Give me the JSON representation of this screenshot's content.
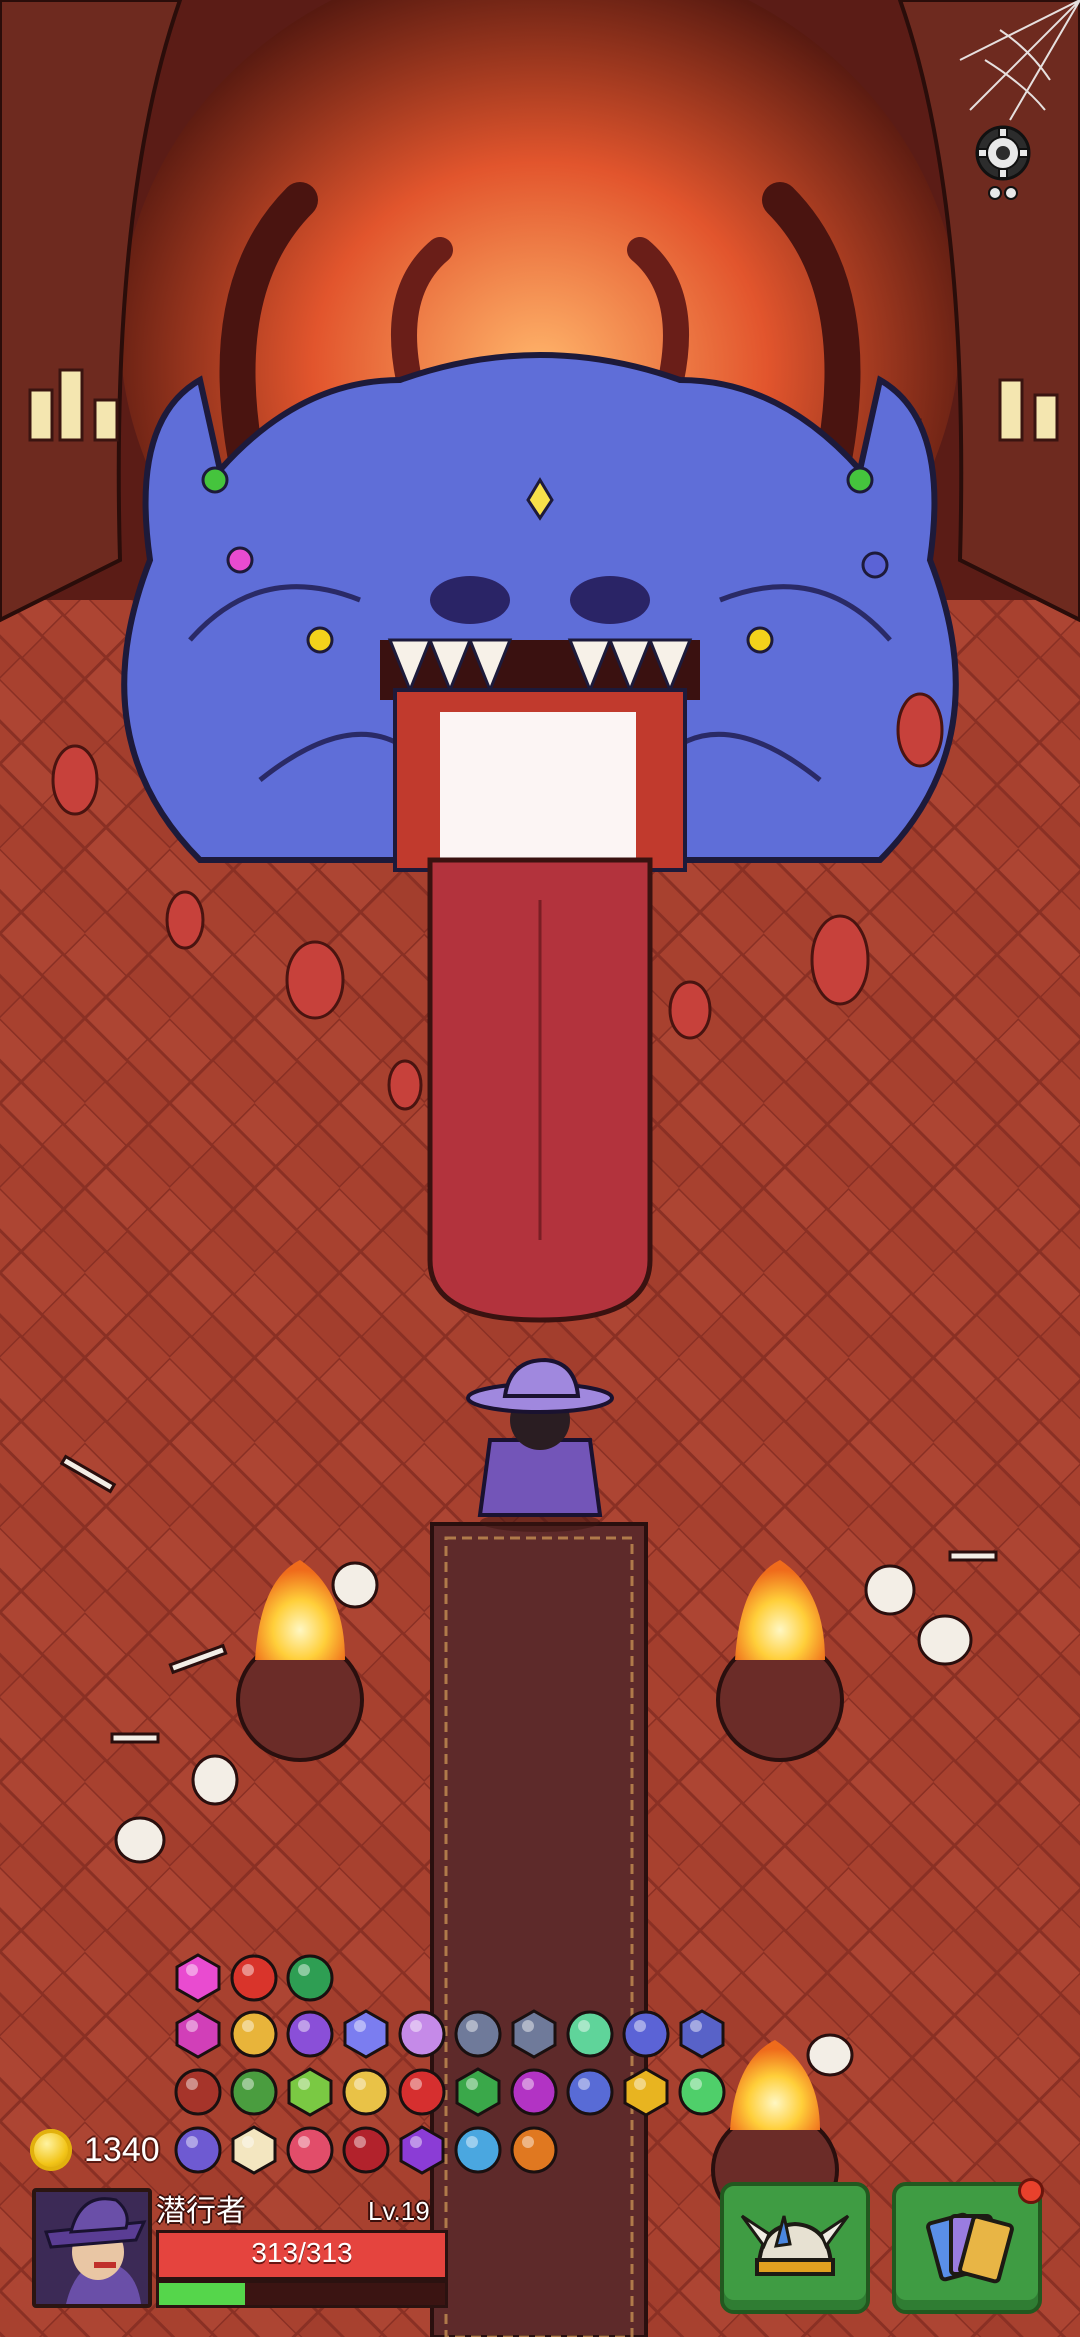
{
  "player": {
    "name": "潜行者",
    "level": "Lv.19",
    "hp_text": "313/313",
    "hp_fraction": 1.0,
    "xp_fraction": 0.3
  },
  "currency": {
    "coins": "1340",
    "icon": "gold-coin-icon"
  },
  "buttons": {
    "settings_icon": "gear-icon",
    "equipment_icon": "viking-helmet-icon",
    "cards_icon": "card-deck-icon"
  },
  "inventory": {
    "items": [
      {
        "icon": "halo-ring-icon",
        "color": "#e94bd0"
      },
      {
        "icon": "fanged-maw-icon",
        "color": "#d9342b"
      },
      {
        "icon": "turtle-shell-icon",
        "color": "#2e9e53"
      },
      {
        "icon": "demon-mask-icon",
        "color": "#d13fb8"
      },
      {
        "icon": "horn-icon",
        "color": "#e8b43a"
      },
      {
        "icon": "shield-badge-icon",
        "color": "#8a4fd8"
      },
      {
        "icon": "blue-flame-icon",
        "color": "#7b7df0"
      },
      {
        "icon": "dice-icon",
        "color": "#c58ae8"
      },
      {
        "icon": "stone-slab-icon",
        "color": "#6f7a9a"
      },
      {
        "icon": "sword-plate-icon",
        "color": "#6f7a9a"
      },
      {
        "icon": "potion-bottle-icon",
        "color": "#5fd49a"
      },
      {
        "icon": "lamp-icon",
        "color": "#5b63d6"
      },
      {
        "icon": "fist-rune-icon",
        "color": "#5862c8"
      },
      {
        "icon": "cube-rune-icon",
        "color": "#a6342a"
      },
      {
        "icon": "star-triangle-icon",
        "color": "#4a9d3f"
      },
      {
        "icon": "green-jar-icon",
        "color": "#7ac943"
      },
      {
        "icon": "flower-pot-icon",
        "color": "#e9c247"
      },
      {
        "icon": "red-demon-icon",
        "color": "#d62f2f"
      },
      {
        "icon": "green-beast-icon",
        "color": "#3aa84a"
      },
      {
        "icon": "purple-gem-icon",
        "color": "#b233c4"
      },
      {
        "icon": "blue-orb-icon",
        "color": "#586bd6"
      },
      {
        "icon": "gold-flower-icon",
        "color": "#e8b420"
      },
      {
        "icon": "green-bracelet-icon",
        "color": "#4fcf6a"
      },
      {
        "icon": "bat-wing-icon",
        "color": "#6e5ad2"
      },
      {
        "icon": "bone-icon",
        "color": "#f3e6c0"
      },
      {
        "icon": "heart-lock-icon",
        "color": "#e24d6a"
      },
      {
        "icon": "red-triangle-icon",
        "color": "#b2222c"
      },
      {
        "icon": "purple-demon-icon",
        "color": "#8b3cd6"
      },
      {
        "icon": "mushroom-icon",
        "color": "#4aa7e0"
      },
      {
        "icon": "bleeding-horn-icon",
        "color": "#e07820"
      }
    ]
  }
}
